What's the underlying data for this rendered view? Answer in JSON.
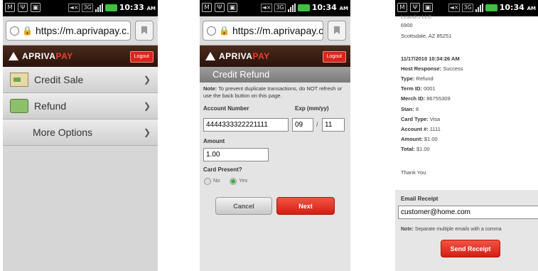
{
  "phones": [
    {
      "status_time": "10:33",
      "status_ampm": "AM",
      "url": "https://m.aprivapay.c...",
      "logo": {
        "part1": "APRIVA",
        "part2": "PAY"
      },
      "logout_label": "Logout",
      "menu": [
        {
          "label": "Credit Sale",
          "icon": "credit-card-icon"
        },
        {
          "label": "Refund",
          "icon": "refund-icon"
        },
        {
          "label": "More Options",
          "icon": ""
        }
      ]
    },
    {
      "status_time": "10:34",
      "status_ampm": "AM",
      "url": "https://m.aprivapay.c...",
      "logo": {
        "part1": "APRIVA",
        "part2": "PAY"
      },
      "logout_label": "Logout",
      "title": "Credit Refund",
      "note_bold": "Note:",
      "note_text": " To prevent duplicate transactions, do NOT refresh or use the back button on this page.",
      "account_label": "Account Number",
      "account_value": "4444333322221111",
      "exp_label": "Exp (mm/yy)",
      "exp_month": "09",
      "exp_year": "11",
      "exp_sep": "/",
      "amount_label": "Amount",
      "amount_value": "1.00",
      "card_present_label": "Card Present?",
      "radio_no": "No",
      "radio_yes": "Yes",
      "cancel_label": "Cancel",
      "next_label": "Next"
    },
    {
      "status_time": "10:34",
      "status_ampm": "AM",
      "merchant_line1": "Leandro LLC",
      "merchant_line2": "6900",
      "merchant_line3": "Scottsdale, AZ 85251",
      "datetime": "11/17/2010 10:34:26 AM",
      "host_response_key": "Host Response:",
      "host_response_val": "Success",
      "type_key": "Type:",
      "type_val": "Refund",
      "term_key": "Term ID:",
      "term_val": "0001",
      "merch_key": "Merch ID:",
      "merch_val": "86755309",
      "stan_key": "Stan:",
      "stan_val": "8",
      "cardtype_key": "Card Type:",
      "cardtype_val": "Visa",
      "account_key": "Account #:",
      "account_val": "1111",
      "amount_key": "Amount:",
      "amount_val": "$1.00",
      "total_key": "Total:",
      "total_val": "$1.00",
      "thank_you": "Thank You",
      "email_label": "Email Receipt",
      "email_value": "customer@home.com",
      "email_note_bold": "Note:",
      "email_note_text": " Separate multiple emails with a comma",
      "send_label": "Send Receipt"
    }
  ],
  "colors": {
    "accent_red": "#d8261c",
    "header_brown": "#3a1f14"
  }
}
